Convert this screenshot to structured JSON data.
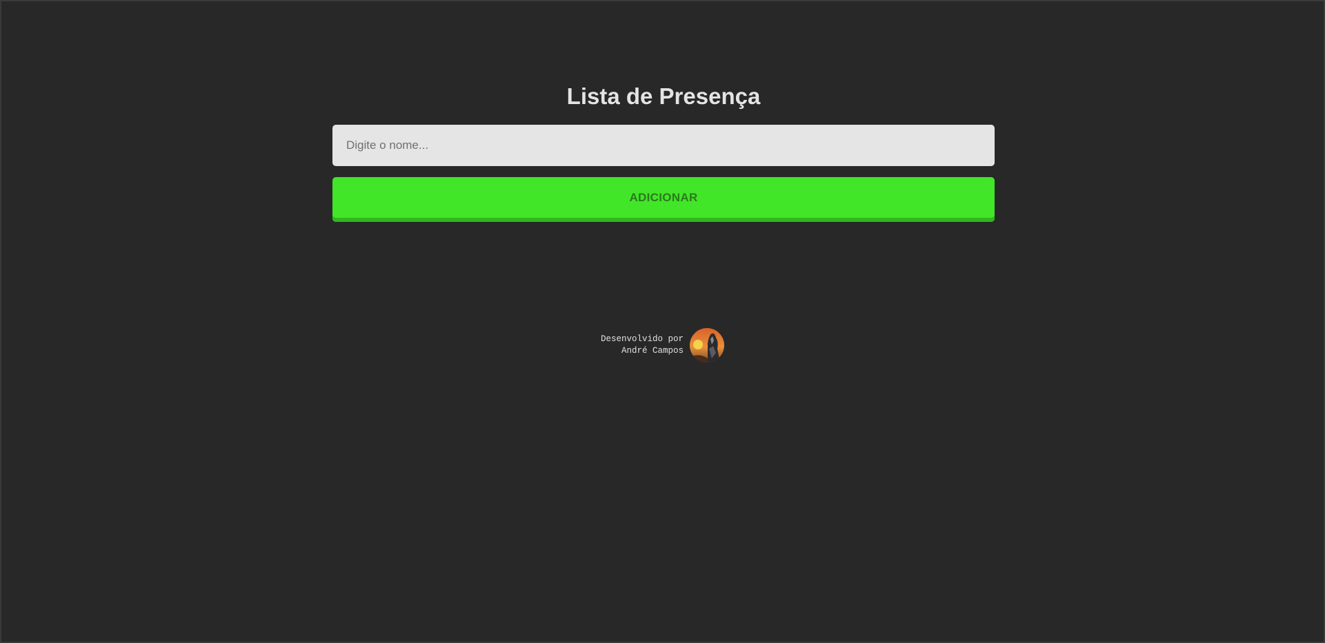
{
  "page": {
    "title": "Lista de Presença"
  },
  "form": {
    "name_placeholder": "Digite o nome...",
    "name_value": "",
    "add_label": "ADICIONAR"
  },
  "footer": {
    "line1": "Desenvolvido por",
    "line2": "André Campos",
    "avatar_icon": "author-avatar"
  },
  "colors": {
    "background": "#282828",
    "accent": "#42e628",
    "accent_shadow": "#2fb81c",
    "input_bg": "#e5e5e5"
  }
}
